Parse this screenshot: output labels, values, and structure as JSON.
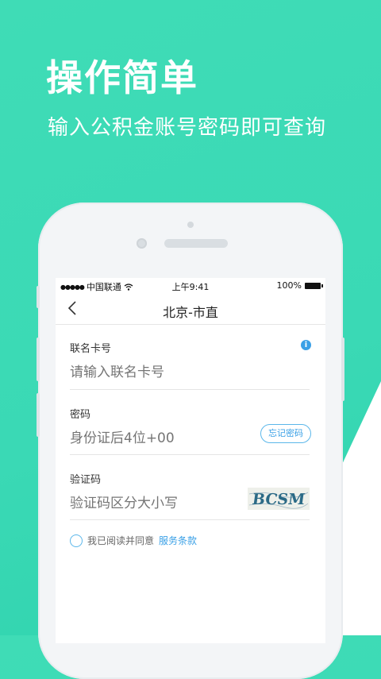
{
  "promo": {
    "headline": "操作简单",
    "subline": "输入公积金账号密码即可查询"
  },
  "status_bar": {
    "signal_dots": "●●●●●",
    "carrier": "中国联通",
    "time": "上午9:41",
    "battery": "100%"
  },
  "nav": {
    "title": "北京-市直",
    "back_icon": "chevron-left-icon"
  },
  "form": {
    "card": {
      "label": "联名卡号",
      "placeholder": "请输入联名卡号",
      "info_icon": "i"
    },
    "password": {
      "label": "密码",
      "placeholder": "身份证后4位+00",
      "forgot_label": "忘记密码"
    },
    "captcha": {
      "label": "验证码",
      "placeholder": "验证码区分大小写",
      "image_text": "BCSM"
    },
    "agreement": {
      "text": "我已阅读并同意",
      "link": "服务条款"
    }
  },
  "colors": {
    "background": "#3ad9b5",
    "accent": "#3aa0e6",
    "white": "#ffffff"
  }
}
